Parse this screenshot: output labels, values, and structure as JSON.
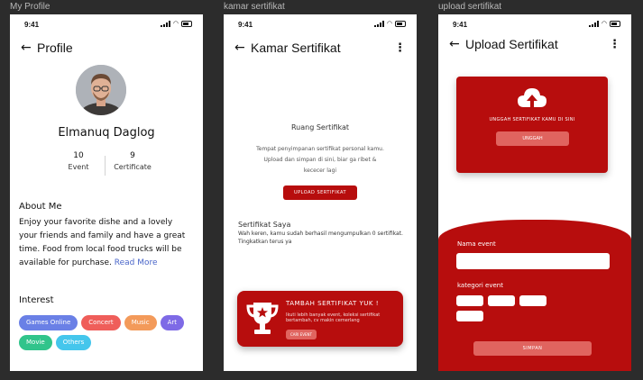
{
  "frames": [
    {
      "label": "My Profile"
    },
    {
      "label": "kamar sertifikat"
    },
    {
      "label": "upload sertifikat"
    }
  ],
  "status": {
    "time": "9:41"
  },
  "profile": {
    "title": "Profile",
    "name": "Elmanuq Daglog",
    "stats": [
      {
        "value": "10",
        "label": "Event"
      },
      {
        "value": "9",
        "label": "Certificate"
      }
    ],
    "about_heading": "About Me",
    "about_text": "Enjoy your favorite dishe and a lovely your friends and family and have a great time. Food from local food trucks will be available for purchase.",
    "read_more": "Read More",
    "interest_heading": "Interest",
    "tags": [
      {
        "label": "Games Online",
        "color": "#6a80e6"
      },
      {
        "label": "Concert",
        "color": "#ef5e5a"
      },
      {
        "label": "Music",
        "color": "#f39a5a"
      },
      {
        "label": "Art",
        "color": "#7e6ae6"
      },
      {
        "label": "Movie",
        "color": "#31c48b"
      },
      {
        "label": "Others",
        "color": "#45c6ec"
      }
    ]
  },
  "kamar": {
    "title": "Kamar Sertifikat",
    "room_title": "Ruang Sertifikat",
    "room_desc": "Tempat penyimpanan sertifikat personal kamu. Upload dan simpan di sini, biar ga ribet & kececer lagi",
    "upload_button": "UPLOAD SERTIFIKAT",
    "saya_title": "Sertifikat Saya",
    "saya_text": "Wah keren, kamu sudah berhasil mengumpulkan 0 sertifikat. Tingkatkan terus ya",
    "promo_title": "TAMBAH SERTIFIKAT YUK !",
    "promo_text": "Ikuti lebih banyak event, koleksi sertifikat bertambah, cv makin cemerlang",
    "promo_button": "CARI EVENT"
  },
  "upload": {
    "title": "Upload Sertifikat",
    "caption": "UNGGAH SERTIFIKAT KAMU DI SINI",
    "pick_button": "UNGGAH",
    "event_name_label": "Nama event",
    "category_label": "kategori event",
    "save_button": "SIMPAN"
  },
  "colors": {
    "brand_red": "#b70d0d",
    "accent_salmon": "#e0645f",
    "link_blue": "#4a66c9"
  }
}
